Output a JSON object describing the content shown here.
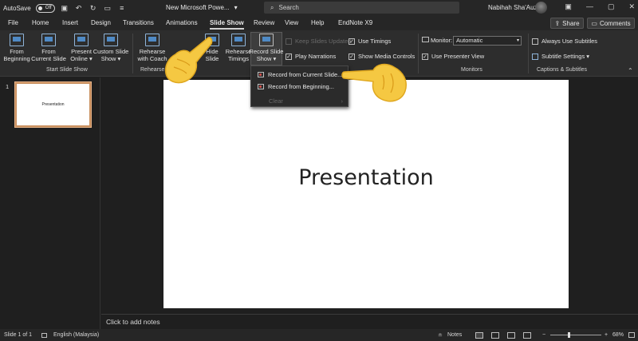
{
  "titlebar": {
    "autosave_label": "AutoSave",
    "autosave_state": "Off",
    "doc_title": "New Microsoft Powe...",
    "doc_caret": "▾",
    "search_placeholder": "Search",
    "user_name": "Nabihah Sha'Auzi"
  },
  "tabs": [
    "File",
    "Home",
    "Insert",
    "Design",
    "Transitions",
    "Animations",
    "Slide Show",
    "Review",
    "View",
    "Help",
    "EndNote X9"
  ],
  "active_tab": "Slide Show",
  "share_label": "Share",
  "comments_label": "Comments",
  "ribbon": {
    "from_beginning": "From\nBeginning",
    "from_current": "From\nCurrent Slide",
    "present_online": "Present\nOnline ▾",
    "custom_slide_show": "Custom Slide\nShow ▾",
    "group_start": "Start Slide Show",
    "rehearse_coach": "Rehearse\nwith Coach",
    "hide_slide": "Hide\nSlide",
    "rehearse_timings": "Rehearse\nTimings",
    "record_slide_show": "Record Slide\nShow ▾",
    "group_rehearse": "Rehearse",
    "keep_slides_updated": "Keep Slides Updated",
    "play_narrations": "Play Narrations",
    "use_timings": "Use Timings",
    "show_media_controls": "Show Media Controls",
    "monitor_label": "Monitor:",
    "monitor_value": "Automatic",
    "use_presenter_view": "Use Presenter View",
    "group_monitors": "Monitors",
    "always_use_subtitles": "Always Use Subtitles",
    "subtitle_settings": "Subtitle Settings ▾",
    "group_captions": "Captions & Subtitles"
  },
  "dropdown": {
    "items": [
      "Record from Current Slide...",
      "Record from Beginning...",
      "Clear"
    ]
  },
  "slide": {
    "number": "1",
    "title": "Presentation",
    "thumb_title": "Presentation"
  },
  "notes_placeholder": "Click to add notes",
  "status": {
    "slide_of": "Slide 1 of 1",
    "language": "English (Malaysia)",
    "notes": "Notes",
    "zoom": "68%"
  }
}
